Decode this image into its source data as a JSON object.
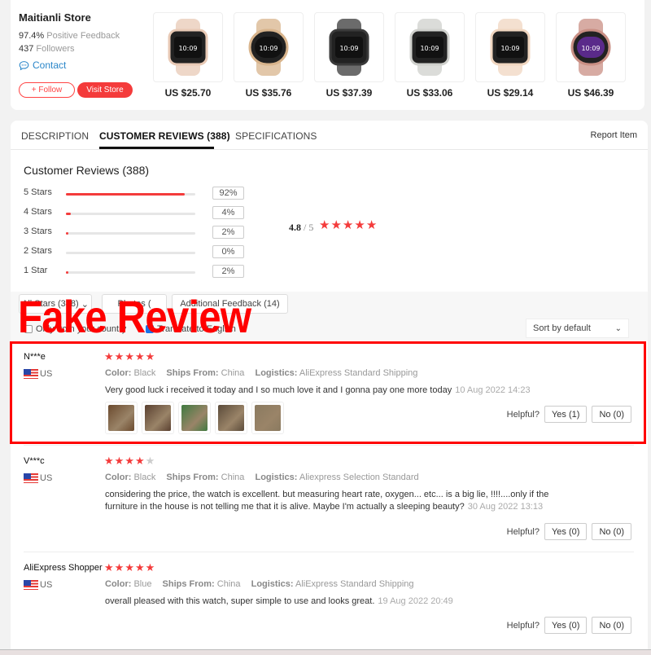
{
  "store": {
    "name": "Maitianli Store",
    "positive_value": "97.4%",
    "positive_label": "Positive Feedback",
    "followers_value": "437",
    "followers_label": "Followers",
    "contact_label": "Contact",
    "follow_label": "+ Follow",
    "visit_label": "Visit Store"
  },
  "products": [
    {
      "price": "US $25.70",
      "color": "#e8c9b5"
    },
    {
      "price": "US $35.76",
      "color": "#d8b48c"
    },
    {
      "price": "US $37.39",
      "color": "#3a3a3a"
    },
    {
      "price": "US $33.06",
      "color": "#cfd0cc"
    },
    {
      "price": "US $29.14",
      "color": "#f0d6c0"
    },
    {
      "price": "US $46.39",
      "color": "#c98f84"
    }
  ],
  "tabs": [
    {
      "label": "DESCRIPTION",
      "active": false
    },
    {
      "label": "CUSTOMER REVIEWS (388)",
      "active": true
    },
    {
      "label": "SPECIFICATIONS",
      "active": false
    }
  ],
  "report_label": "Report Item",
  "reviews_summary": {
    "title": "Customer Reviews (388)",
    "distribution": [
      {
        "label": "5 Stars",
        "pct_text": "92%",
        "fraction": 0.92
      },
      {
        "label": "4 Stars",
        "pct_text": "4%",
        "fraction": 0.04
      },
      {
        "label": "3 Stars",
        "pct_text": "2%",
        "fraction": 0.02
      },
      {
        "label": "2 Stars",
        "pct_text": "0%",
        "fraction": 0.0
      },
      {
        "label": "1 Star",
        "pct_text": "2%",
        "fraction": 0.02
      }
    ],
    "average": "4.8",
    "average_max": "/ 5",
    "average_stars": 5
  },
  "filters": {
    "all_stars": "All Stars (388)",
    "photos": "Photos (",
    "additional": "Additional Feedback (14)",
    "only_country": "Only from your country",
    "translate": "Translate to English",
    "translate_checked": true,
    "only_country_checked": false,
    "sort": "Sort by default"
  },
  "overlay": {
    "text": "Fake Review",
    "color": "#ff0000"
  },
  "reviews": [
    {
      "name": "N***e",
      "country": "US",
      "stars": 5,
      "color_label": "Color:",
      "color_value": "Black",
      "ships_label": "Ships From:",
      "ships_value": "China",
      "logistics_label": "Logistics:",
      "logistics_value": "AliExpress Standard Shipping",
      "text": "Very good luck i received it today and I so much love it and I gonna pay one more today",
      "date": "10 Aug 2022 14:23",
      "photos": [
        "#6b4a2e",
        "#5a4030",
        "#3f7a40",
        "#5b4b3a",
        "#8a7a60"
      ],
      "helpful_label": "Helpful?",
      "yes": "Yes (1)",
      "no": "No (0)"
    },
    {
      "name": "V***c",
      "country": "US",
      "stars": 4,
      "color_label": "Color:",
      "color_value": "Black",
      "ships_label": "Ships From:",
      "ships_value": "China",
      "logistics_label": "Logistics:",
      "logistics_value": "Aliexpress Selection Standard",
      "text": "considering the price, the watch is excellent. but measuring heart rate, oxygen... etc... is a big lie, !!!!....only if the furniture in the house is not telling me that it is alive. Maybe I'm actually a sleeping beauty?",
      "date": "30 Aug 2022 13:13",
      "photos": [],
      "helpful_label": "Helpful?",
      "yes": "Yes (0)",
      "no": "No (0)"
    },
    {
      "name": "AliExpress Shopper",
      "country": "US",
      "stars": 5,
      "color_label": "Color:",
      "color_value": "Blue",
      "ships_label": "Ships From:",
      "ships_value": "China",
      "logistics_label": "Logistics:",
      "logistics_value": "AliExpress Standard Shipping",
      "text": "overall pleased with this watch, super simple to use and looks great.",
      "date": "19 Aug 2022 20:49",
      "photos": [],
      "helpful_label": "Helpful?",
      "yes": "Yes (0)",
      "no": "No (0)"
    }
  ]
}
